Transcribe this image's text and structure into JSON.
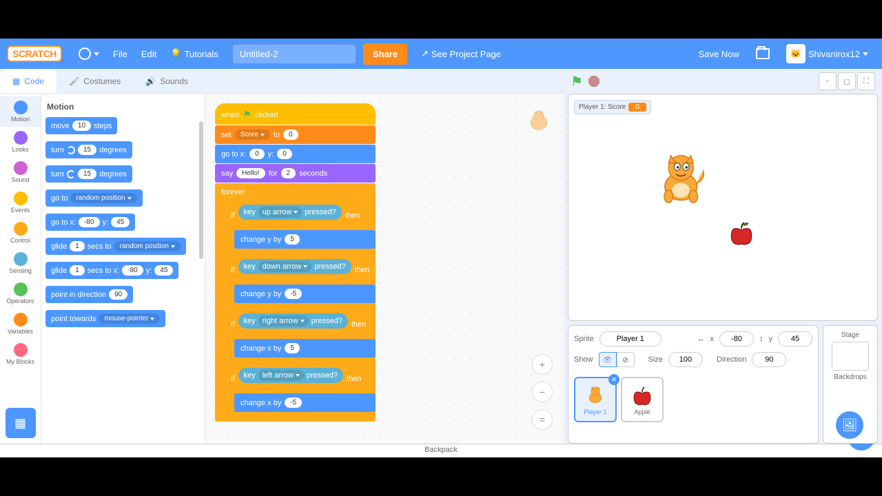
{
  "menubar": {
    "logo": "SCRATCH",
    "file": "File",
    "edit": "Edit",
    "tutorials": "Tutorials",
    "title": "Untitled-2",
    "share": "Share",
    "project_page": "See Project Page",
    "save_now": "Save Now",
    "username": "Shivanirox12"
  },
  "tabs": {
    "code": "Code",
    "costumes": "Costumes",
    "sounds": "Sounds"
  },
  "categories": [
    {
      "name": "Motion",
      "color": "#4c97ff"
    },
    {
      "name": "Looks",
      "color": "#9966ff"
    },
    {
      "name": "Sound",
      "color": "#cf63cf"
    },
    {
      "name": "Events",
      "color": "#ffbf00"
    },
    {
      "name": "Control",
      "color": "#ffab19"
    },
    {
      "name": "Sensing",
      "color": "#5cb1d6"
    },
    {
      "name": "Operators",
      "color": "#59c059"
    },
    {
      "name": "Variables",
      "color": "#ff8c1a"
    },
    {
      "name": "My Blocks",
      "color": "#ff6680"
    }
  ],
  "palette": {
    "heading": "Motion",
    "move_steps_a": "move",
    "move_steps_v": "10",
    "move_steps_b": "steps",
    "turn_cw_a": "turn",
    "turn_cw_v": "15",
    "turn_cw_b": "degrees",
    "turn_ccw_a": "turn",
    "turn_ccw_v": "15",
    "turn_ccw_b": "degrees",
    "goto_a": "go to",
    "goto_v": "random position",
    "gotoxy_a": "go to x:",
    "gotoxy_x": "-80",
    "gotoxy_b": "y:",
    "gotoxy_y": "45",
    "glide_a": "glide",
    "glide_s": "1",
    "glide_b": "secs to",
    "glide_v": "random position",
    "glidexy_a": "glide",
    "glidexy_s": "1",
    "glidexy_b": "secs to x:",
    "glidexy_x": "-80",
    "glidexy_c": "y:",
    "glidexy_y": "45",
    "point_dir_a": "point in direction",
    "point_dir_v": "90",
    "point_tw_a": "point towards",
    "point_tw_v": "mouse-pointer"
  },
  "script": {
    "when_clicked": "when",
    "clicked": "clicked",
    "set_a": "set",
    "set_var": "Score",
    "set_b": "to",
    "set_v": "0",
    "gotoxy_a": "go to x:",
    "gotoxy_x": "0",
    "gotoxy_b": "y:",
    "gotoxy_y": "0",
    "say_a": "say",
    "say_msg": "Hello!",
    "say_b": "for",
    "say_s": "2",
    "say_c": "seconds",
    "forever": "forever",
    "if": "if",
    "then": "then",
    "key": "key",
    "pressed": "pressed?",
    "up": "up arrow",
    "down": "down arrow",
    "right": "right arrow",
    "left": "left arrow",
    "chy": "change y by",
    "chx": "change x by",
    "p5": "5",
    "m5": "-5"
  },
  "stage": {
    "score_label": "Player 1: Score",
    "score_val": "0"
  },
  "sprite_info": {
    "sprite_label": "Sprite",
    "sprite_name": "Player 1",
    "x_label": "x",
    "x_val": "-80",
    "y_label": "y",
    "y_val": "45",
    "show_label": "Show",
    "size_label": "Size",
    "size_val": "100",
    "dir_label": "Direction",
    "dir_val": "90"
  },
  "sprites": {
    "player1": "Player 1",
    "apple": "Apple"
  },
  "stage_panel": {
    "stage": "Stage",
    "backdrops": "Backdrops"
  },
  "backpack": "Backpack"
}
